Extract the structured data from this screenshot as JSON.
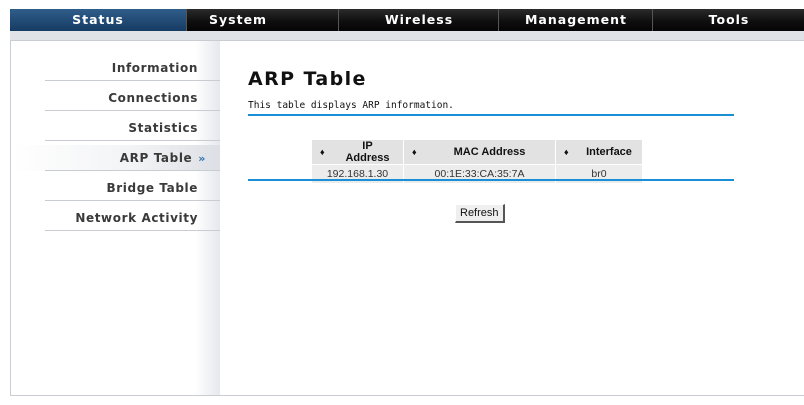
{
  "nav": {
    "items": [
      {
        "label": "Status",
        "active": true
      },
      {
        "label": "System",
        "active": false
      },
      {
        "label": "Wireless",
        "active": false
      },
      {
        "label": "Management",
        "active": false
      },
      {
        "label": "Tools",
        "active": false
      }
    ]
  },
  "sidebar": {
    "items": [
      {
        "label": "Information"
      },
      {
        "label": "Connections"
      },
      {
        "label": "Statistics"
      },
      {
        "label": "ARP Table",
        "active": true
      },
      {
        "label": "Bridge Table"
      },
      {
        "label": "Network Activity"
      }
    ],
    "active_marker": "»"
  },
  "page": {
    "title": "ARP Table",
    "description": "This table displays ARP information."
  },
  "arp_table": {
    "sort_icon": "♦",
    "headers": [
      "IP Address",
      "MAC Address",
      "Interface"
    ],
    "rows": [
      [
        "192.168.1.30",
        "00:1E:33:CA:35:7A",
        "br0"
      ]
    ]
  },
  "buttons": {
    "refresh_label": "Refresh"
  },
  "colors": {
    "accent_rule": "#1a8fd6",
    "nav_active": "#163b63",
    "nav_bg": "#0f0f0f"
  }
}
